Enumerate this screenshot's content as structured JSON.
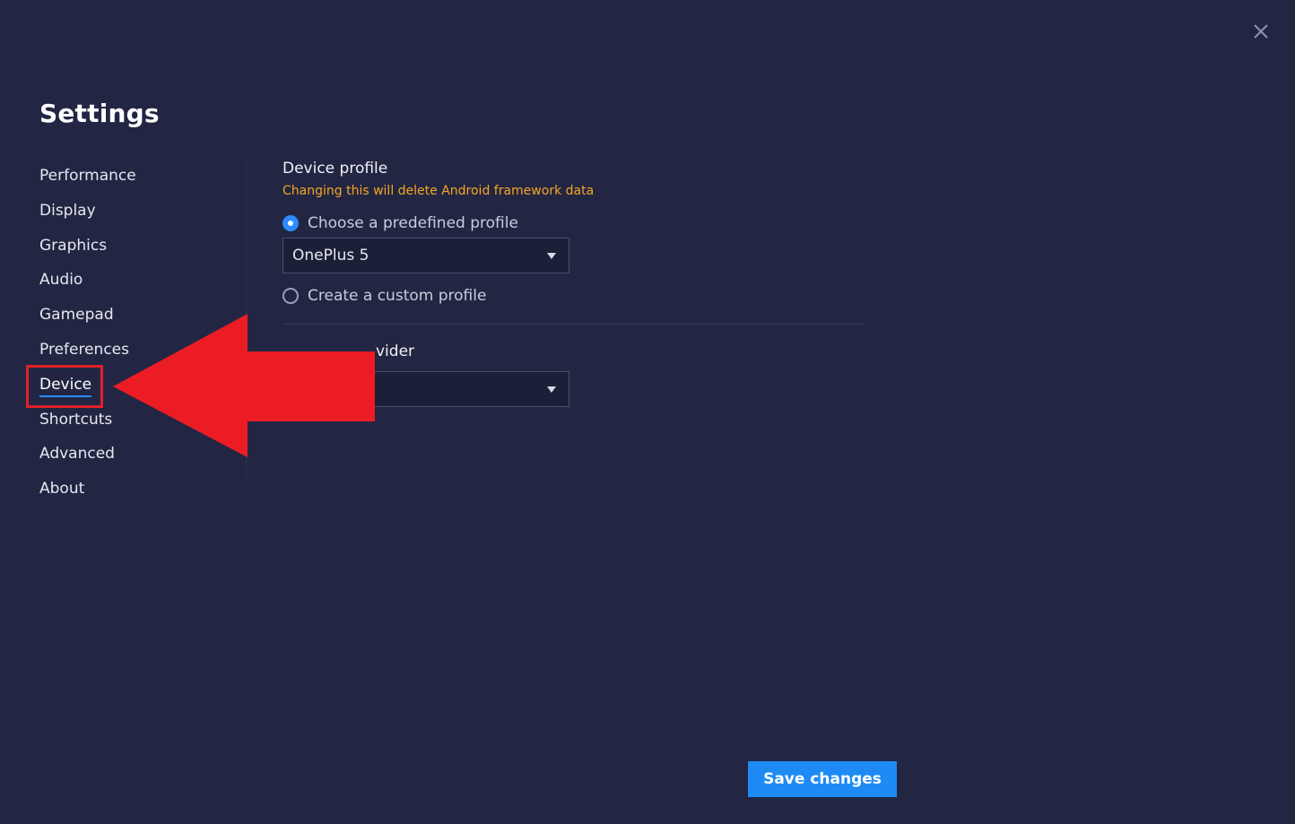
{
  "window": {
    "title": "Settings",
    "close_icon": "close-icon"
  },
  "sidebar": {
    "items": [
      {
        "label": "Performance",
        "active": false
      },
      {
        "label": "Display",
        "active": false
      },
      {
        "label": "Graphics",
        "active": false
      },
      {
        "label": "Audio",
        "active": false
      },
      {
        "label": "Gamepad",
        "active": false
      },
      {
        "label": "Preferences",
        "active": false
      },
      {
        "label": "Device",
        "active": true
      },
      {
        "label": "Shortcuts",
        "active": false
      },
      {
        "label": "Advanced",
        "active": false
      },
      {
        "label": "About",
        "active": false
      }
    ]
  },
  "device": {
    "section_title": "Device profile",
    "warning": "Changing this will delete Android framework data",
    "option_predefined": {
      "label": "Choose a predefined profile",
      "selected": true
    },
    "profile_select": {
      "value": "OnePlus 5"
    },
    "option_custom": {
      "label": "Create a custom profile",
      "selected": false
    },
    "network_title_visible": "vider",
    "network_select": {
      "value": ""
    }
  },
  "footer": {
    "save_label": "Save changes"
  },
  "colors": {
    "background": "#222643",
    "accent": "#1e8bf5",
    "warning": "#f5a623",
    "annotation": "#e0202a"
  }
}
